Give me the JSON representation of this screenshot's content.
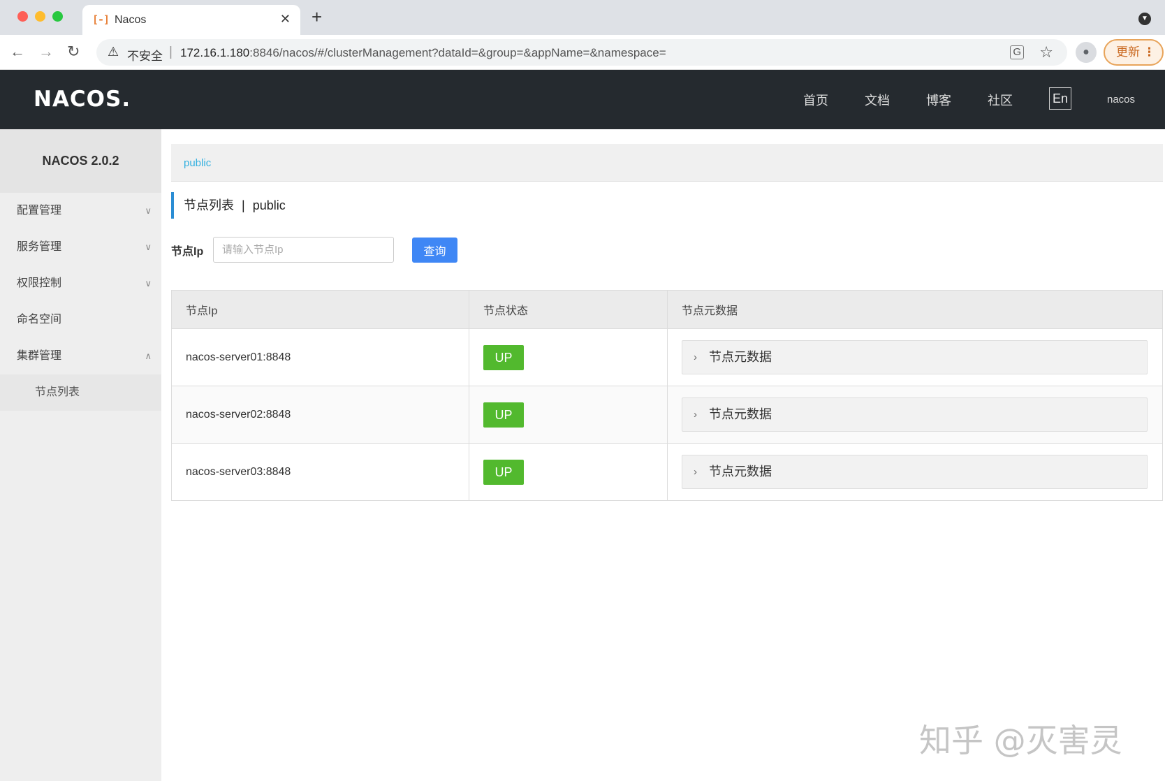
{
  "browser": {
    "tab_favicon": "[-]",
    "tab_title": "Nacos",
    "tab_close": "✕",
    "new_tab": "+",
    "security_text": "不安全",
    "url_host": "172.16.1.180",
    "url_rest": ":8846/nacos/#/clusterManagement?dataId=&group=&appName=&namespace=",
    "update_label": "更新"
  },
  "header": {
    "logo": "NACOS.",
    "nav": [
      "首页",
      "文档",
      "博客",
      "社区"
    ],
    "lang": "En",
    "user": "nacos"
  },
  "sidebar": {
    "title": "NACOS 2.0.2",
    "items": [
      {
        "label": "配置管理",
        "arrow": "∨"
      },
      {
        "label": "服务管理",
        "arrow": "∨"
      },
      {
        "label": "权限控制",
        "arrow": "∨"
      },
      {
        "label": "命名空间",
        "arrow": ""
      },
      {
        "label": "集群管理",
        "arrow": "∧"
      }
    ],
    "sub_items": [
      "节点列表"
    ]
  },
  "main": {
    "namespace": "public",
    "page_title": "节点列表",
    "page_title_sep": "|",
    "page_title_ns": "public",
    "search": {
      "label": "节点Ip",
      "placeholder": "请输入节点Ip",
      "value": "",
      "button": "查询"
    },
    "table": {
      "columns": [
        "节点Ip",
        "节点状态",
        "节点元数据"
      ],
      "rows": [
        {
          "ip": "nacos-server01:8848",
          "status": "UP",
          "meta": "节点元数据"
        },
        {
          "ip": "nacos-server02:8848",
          "status": "UP",
          "meta": "节点元数据"
        },
        {
          "ip": "nacos-server03:8848",
          "status": "UP",
          "meta": "节点元数据"
        }
      ]
    }
  },
  "watermark": "知乎 @灭害灵",
  "colors": {
    "header_bg": "#252a2f",
    "accent_blue": "#3f87f5",
    "status_up": "#52b92e",
    "link": "#33b0e0"
  }
}
